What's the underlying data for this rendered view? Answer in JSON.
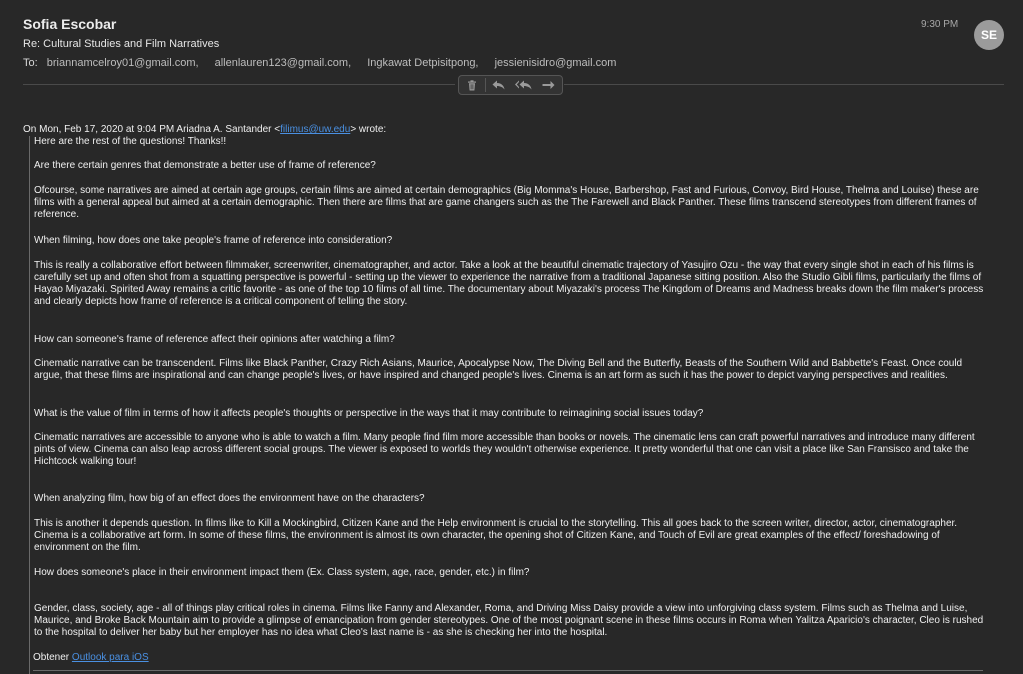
{
  "email": {
    "sender": "Sofia Escobar",
    "subject": "Re: Cultural Studies and Film Narratives",
    "to_label": "To:",
    "recipients": [
      "briannamcelroy01@gmail.com,",
      "allenlauren123@gmail.com,",
      "Ingkawat Detpisitpong,",
      "jessienisidro@gmail.com"
    ],
    "time": "9:30 PM",
    "avatar_initials": "SE"
  },
  "toolbar": {
    "icons": [
      "trash-icon",
      "reply-icon",
      "reply-all-icon",
      "forward-icon"
    ]
  },
  "body": {
    "wrote_prefix": "On Mon, Feb 17, 2020 at 9:04 PM Ariadna A. Santander <",
    "wrote_email": "filimus@uw.edu",
    "wrote_suffix": "> wrote:",
    "paragraphs": [
      "Here are the rest of the questions!  Thanks!!",
      "Are there certain genres that demonstrate a better use of frame of reference?",
      "Ofcourse, some narratives are aimed at certain age groups, certain films are aimed at certain demographics (Big Momma's House, Barbershop, Fast and Furious, Convoy, Bird House, Thelma and Louise)  these are films with a general appeal but aimed at a certain demographic. Then there are films that are game changers such as the The Farewell and Black Panther.  These films transcend stereotypes from different frames of reference.",
      "When filming, how does one take people's frame of reference into consideration?",
      "This is really a collaborative effort between filmmaker, screenwriter, cinematographer, and actor.  Take a look at the beautiful cinematic trajectory of Yasujiro Ozu - the way that every single shot in each of his films is carefully set up and often shot from  a squatting perspective is powerful - setting up the viewer to experience the narrative from a traditional Japanese sitting position.  Also the Studio Gibli films, particularly the films of Hayao Miyazaki.  Spirited Away remains a critic favorite - as one of the top 10 films of all time.  The documentary about Miyazaki's process The Kingdom of Dreams and Madness breaks down the film maker's process and clearly depicts how frame of reference is a critical component of telling the story.",
      "How can someone's frame of reference affect their opinions after watching a film?",
      "Cinematic narrative can be transcendent.   Films like Black Panther, Crazy Rich Asians, Maurice, Apocalypse Now, The Diving Bell and the Butterfly, Beasts of the Southern Wild and Babbette's Feast. Once could argue, that these films are inspirational and can change people's lives, or have inspired and changed people's lives.   Cinema is an art form as such it has the power to depict varying perspectives and realities.",
      "What is the value of film in terms of how it affects people's thoughts or perspective in the ways that it may contribute to reimagining social issues today?",
      "Cinematic narratives are accessible to anyone who is able to watch a film.  Many people find film more accessible than books or novels.  The cinematic lens can craft powerful narratives and introduce many different pints of view.   Cinema can also leap across different social groups.  The viewer is exposed to worlds they wouldn't otherwise experience.  It pretty wonderful that one can visit a place like San Fransisco and take the  Hichtcock walking tour!",
      "When analyzing film, how big of an effect does the environment have on the characters?",
      "This is another it depends question.  In films like to Kill a Mockingbird, Citizen Kane and the Help environment is crucial to the storytelling.  This all goes back to the screen writer, director, actor, cinematographer. Cinema is a collaborative art form. In some of these films, the environment is almost its own character, the opening shot of Citizen Kane, and Touch of Evil are great examples of the effect/ foreshadowing of environment on the film.",
      "How does someone's place in their environment impact them (Ex. Class system, age, race, gender, etc.) in film?",
      "Gender, class, society, age - all of things play critical roles in cinema.  Films like Fanny and Alexander, Roma, and Driving Miss Daisy provide a view into unforgiving class system.  Films such as Thelma and Luise,  Maurice, and Broke Back Mountain aim to provide a glimpse of emancipation from gender stereotypes. One of the most poignant scene in these films occurs in Roma when Yalitza Aparicio's character, Cleo is rushed to the hospital to deliver her baby but her employer has no idea what Cleo's last name is - as she is checking her into the hospital."
    ],
    "signature_prefix": "Obtener ",
    "signature_link": "Outlook para iOS"
  }
}
